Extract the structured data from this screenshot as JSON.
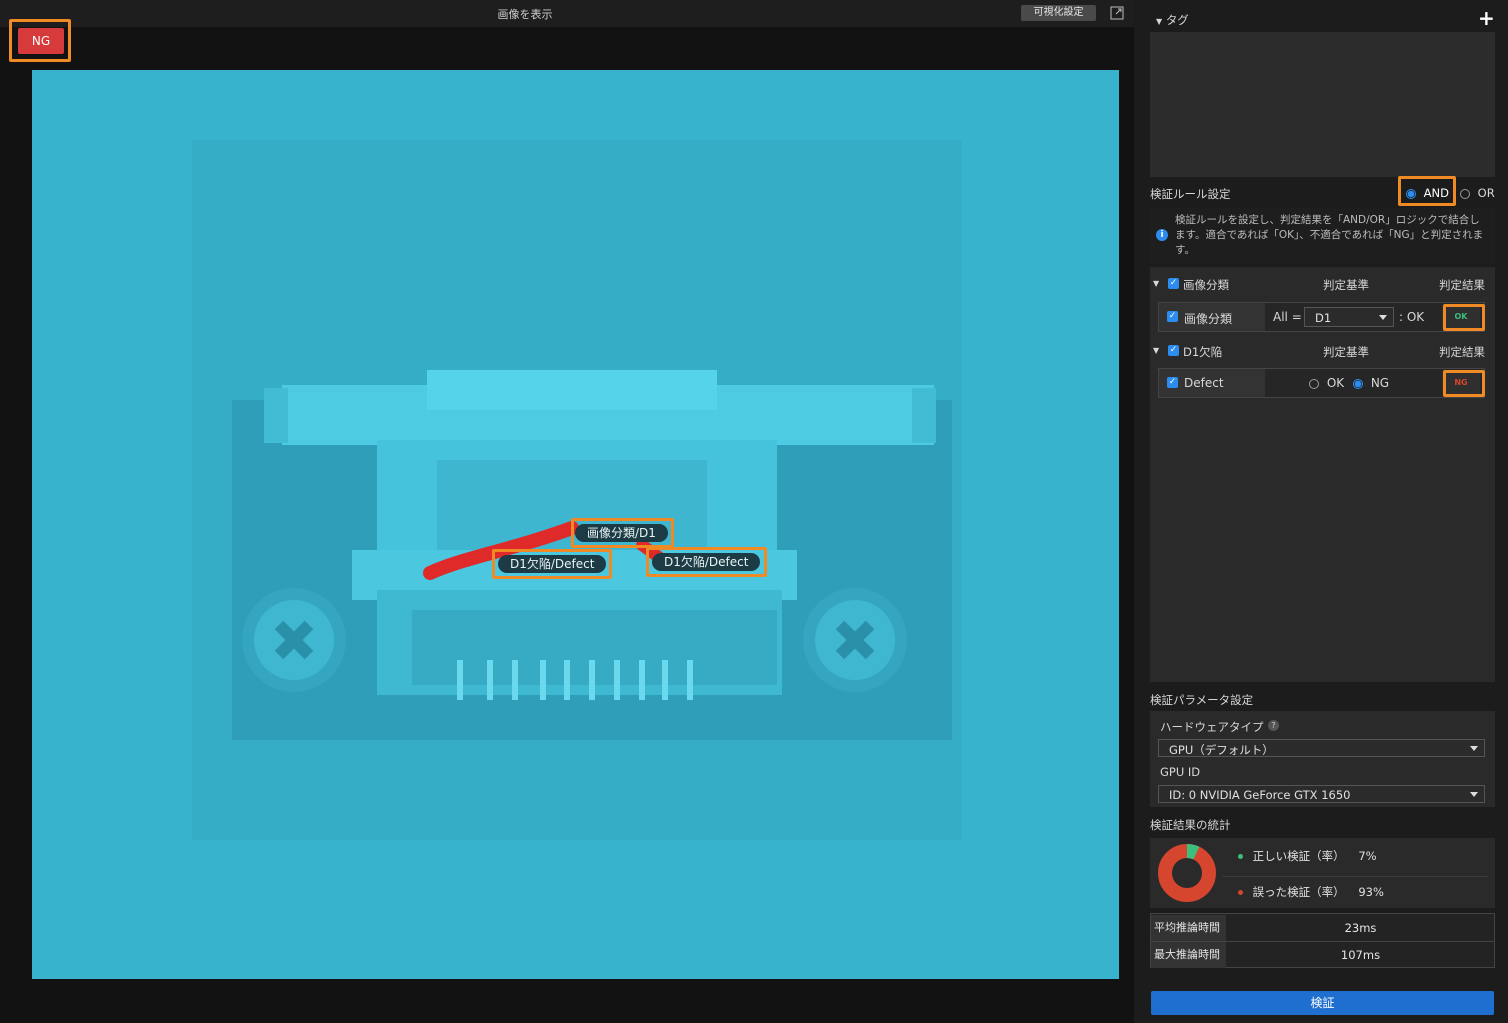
{
  "viewer": {
    "title": "画像を表示",
    "visual_settings_label": "可視化設定",
    "verdict_badge": "NG",
    "labels": [
      {
        "text": "画像分類/D1"
      },
      {
        "text": "D1欠陥/Defect"
      },
      {
        "text": "D1欠陥/Defect"
      }
    ]
  },
  "panel": {
    "tag_section_title": "タグ",
    "rule_section_title": "検証ルール設定",
    "logic_options": [
      "AND",
      "OR"
    ],
    "logic_selected": "AND",
    "info_text": "検証ルールを設定し、判定結果を「AND/OR」ロジックで結合します。適合であれば「OK」、不適合であれば「NG」と判定されます。",
    "groups": [
      {
        "name": "画像分類",
        "criteria_header": "判定基準",
        "result_header": "判定結果",
        "row": {
          "name": "画像分類",
          "prefix": "All =",
          "select_value": "D1",
          "suffix": ": OK",
          "result": "OK"
        }
      },
      {
        "name": "D1欠陥",
        "criteria_header": "判定基準",
        "result_header": "判定結果",
        "row": {
          "name": "Defect",
          "options": [
            "OK",
            "NG"
          ],
          "selected": "NG",
          "result": "NG"
        }
      }
    ],
    "param_section_title": "検証パラメータ設定",
    "hardware_type_label": "ハードウェアタイプ",
    "hardware_type_value": "GPU（デフォルト）",
    "gpu_id_label": "GPU ID",
    "gpu_id_value": "ID: 0  NVIDIA GeForce GTX 1650",
    "stats_section_title": "検証結果の統計",
    "stats": [
      {
        "label": "正しい検証（率）",
        "value": "7%",
        "color": "#3cbf7d",
        "fraction": 0.07
      },
      {
        "label": "誤った検証（率）",
        "value": "93%",
        "color": "#d6462f",
        "fraction": 0.93
      }
    ],
    "times": [
      {
        "label": "平均推論時間",
        "value": "23ms"
      },
      {
        "label": "最大推論時間",
        "value": "107ms"
      }
    ],
    "verify_button": "検証"
  },
  "colors": {
    "accent": "#2d8cf0",
    "ng": "#d63a3a",
    "highlight": "#f08a24",
    "ok_text": "#3cbf7d"
  }
}
